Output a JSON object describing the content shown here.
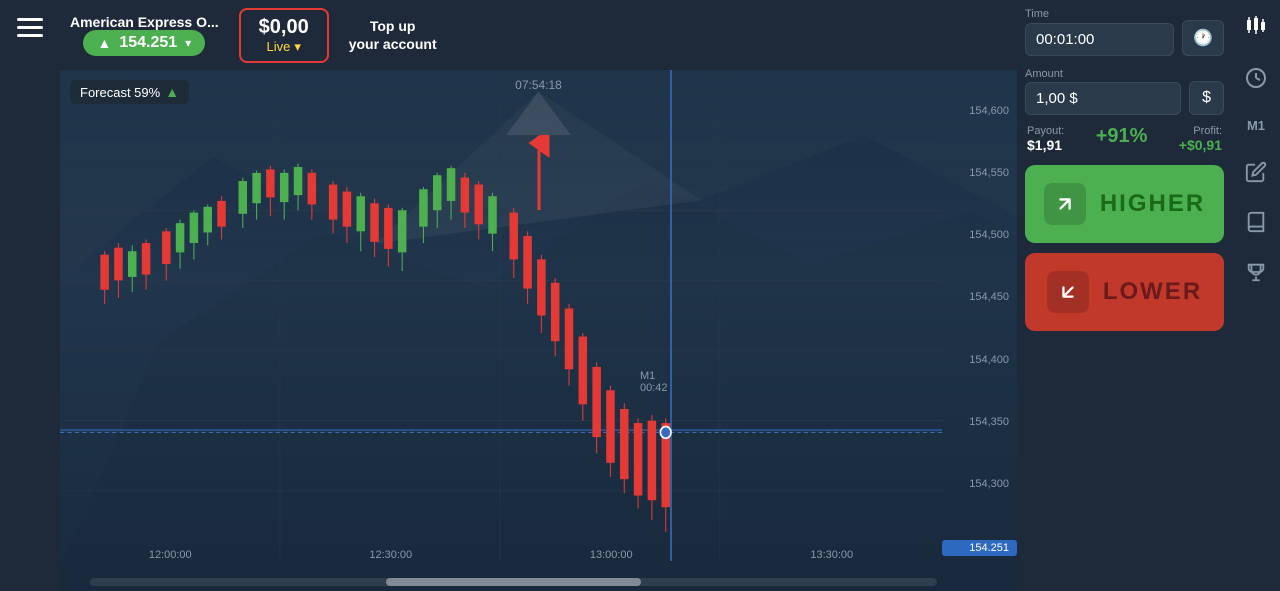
{
  "sidebar": {
    "hamburger_label": "Menu"
  },
  "topbar": {
    "asset_name": "American Express O...",
    "asset_price": "154.251",
    "balance": "$0,00",
    "live_label": "Live",
    "top_up_label": "Top up\nyour account"
  },
  "controls": {
    "time_label": "Time",
    "time_value": "00:01:00",
    "amount_label": "Amount",
    "amount_value": "1,00 $",
    "currency_symbol": "$",
    "payout_label": "Payout:",
    "payout_value": "$1,91",
    "payout_percent": "+91%",
    "profit_label": "Profit:",
    "profit_value": "+$0,91",
    "higher_label": "HIGHER",
    "lower_label": "LOWER"
  },
  "chart": {
    "time_header": "07:54:18",
    "m1_label": "M1",
    "countdown_label": "00:42",
    "forecast_label": "Forecast 59%",
    "current_price": "154.251",
    "price_axis": [
      "154,600",
      "154,550",
      "154,500",
      "154,450",
      "154,400",
      "154,350",
      "154,300"
    ],
    "time_axis": [
      "12:00:00",
      "12:30:00",
      "13:00:00",
      "13:30:00"
    ]
  },
  "far_right_icons": {
    "candlestick": "📊",
    "clock": "🕐",
    "timeframe": "M1",
    "edit": "✏️",
    "book": "📖",
    "trophy": "🏆"
  }
}
